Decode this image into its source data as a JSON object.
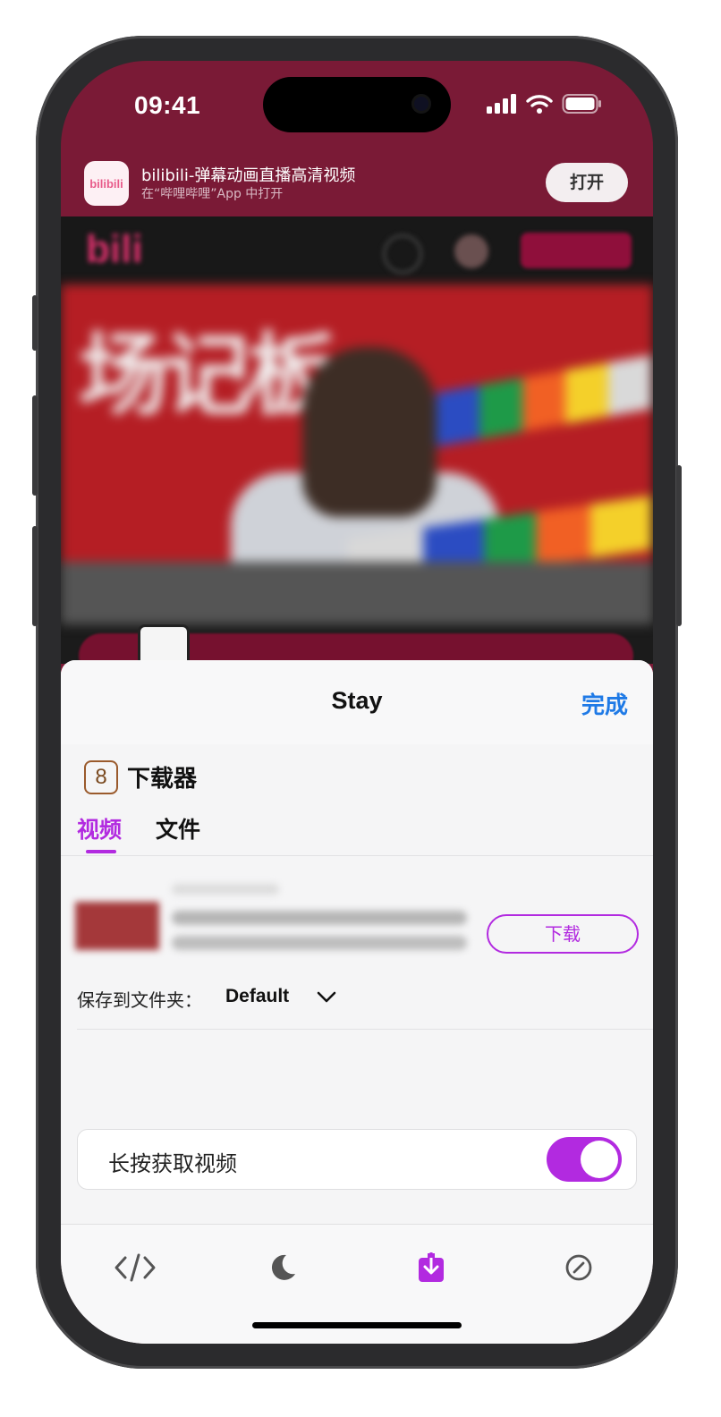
{
  "status": {
    "time": "09:41"
  },
  "app_banner": {
    "title": "bilibili-弹幕动画直播高清视频",
    "subtitle": "在“哔哩哔哩”App 中打开",
    "open_label": "打开",
    "logo_text": "bilibili"
  },
  "sheet": {
    "title": "Stay",
    "done_label": "完成",
    "downloader": {
      "badge": "8",
      "name": "下载器",
      "tabs": [
        {
          "label": "视频",
          "active": true
        },
        {
          "label": "文件",
          "active": false
        }
      ],
      "item": {
        "download_label": "下载"
      },
      "save_label": "保存到文件夹：",
      "save_value": "Default",
      "long_press_label": "长按获取视频",
      "long_press_enabled": true
    }
  },
  "tabbar": [
    {
      "icon": "code-icon",
      "active": false
    },
    {
      "icon": "moon-icon",
      "active": false
    },
    {
      "icon": "download-icon",
      "active": true
    },
    {
      "icon": "block-icon",
      "active": false
    }
  ],
  "colors": {
    "accent": "#b22ae0",
    "link": "#1f7ae6",
    "banner": "#7a1a36"
  }
}
